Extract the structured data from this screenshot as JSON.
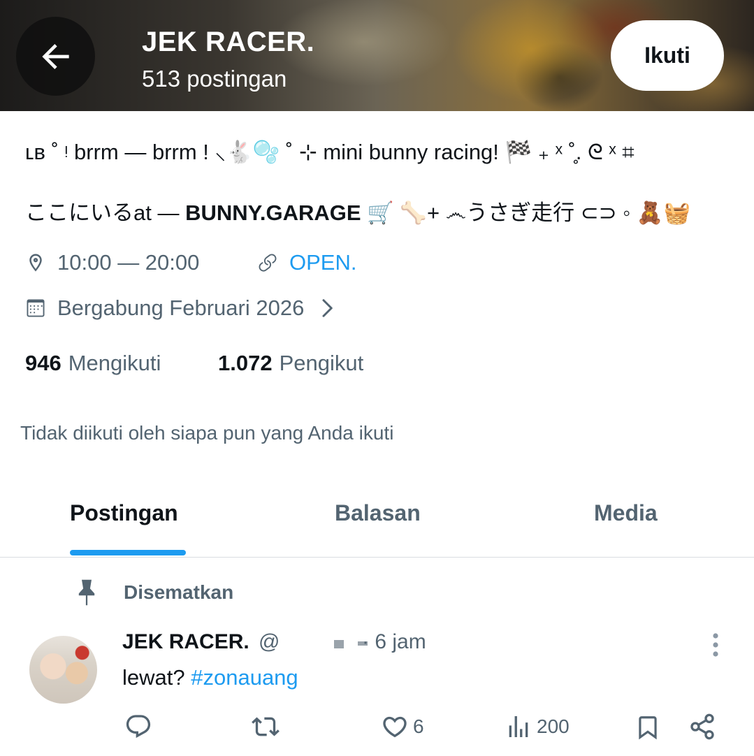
{
  "header": {
    "name": "JEK RACER.",
    "posts_count": "513 postingan",
    "follow_label": "Ikuti"
  },
  "bio": {
    "line1": "ʟʙ ˚ ᵎ brrm — brrm ! ⸜🐇🫧 ˚ ⊹ mini bunny racing! 🏁  ₊ ˣ ˚̥. ᘓ ˣ ⌗",
    "line2_prefix": "ここにいるat — ",
    "line2_bold": "BUNNY.GARAGE",
    "line2_suffix": " 🛒 🦴+ ෴うさぎ走行 ⊂⊃ ◦ 🧸🧺"
  },
  "meta": {
    "location": "10:00 — 20:00",
    "link": "OPEN.",
    "joined": "Bergabung Februari 2026"
  },
  "stats": {
    "following_count": "946",
    "following_label": "Mengikuti",
    "followers_count": "1.072",
    "followers_label": "Pengikut"
  },
  "not_followed_text": "Tidak diikuti oleh siapa pun yang Anda ikuti",
  "tabs": [
    {
      "label": "Postingan",
      "active": true
    },
    {
      "label": "Balasan",
      "active": false
    },
    {
      "label": "Media",
      "active": false
    }
  ],
  "pinned_post": {
    "pinned_label": "Disematkan",
    "author": "JEK RACER.",
    "handle_prefix": "@",
    "time": "· 6 jam",
    "text": "lewat? ",
    "hashtag": "#zonauang",
    "likes": "6",
    "views": "200"
  },
  "colors": {
    "accent": "#1d9bf0",
    "text_primary": "#0f1419",
    "text_secondary": "#536471"
  }
}
